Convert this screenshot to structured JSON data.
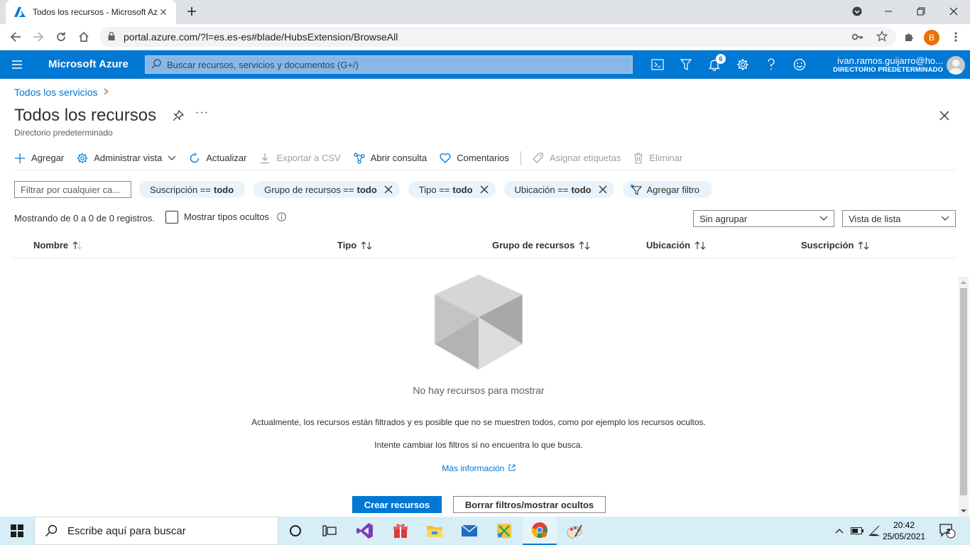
{
  "browser": {
    "tab_title": "Todos los recursos - Microsoft Azure",
    "url": "portal.azure.com/?l=es.es-es#blade/HubsExtension/BrowseAll",
    "profile_initial": "B"
  },
  "azure": {
    "brand": "Microsoft Azure",
    "search_placeholder": "Buscar recursos, servicios y documentos (G+/)",
    "notifications_count": "6",
    "user_name": "ivan.ramos.guijarro@ho...",
    "user_directory": "DIRECTORIO PREDETERMINADO"
  },
  "blade": {
    "breadcrumb": "Todos los servicios",
    "title": "Todos los recursos",
    "more": "···",
    "subtitle": "Directorio predeterminado"
  },
  "commands": {
    "add": "Agregar",
    "manage_view": "Administrar vista",
    "refresh": "Actualizar",
    "export_csv": "Exportar a CSV",
    "open_query": "Abrir consulta",
    "feedback": "Comentarios",
    "assign_tags": "Asignar etiquetas",
    "delete": "Eliminar"
  },
  "filters": {
    "placeholder": "Filtrar por cualquier ca...",
    "subscription_key": "Suscripción ==",
    "subscription_val": "todo",
    "rg_key": "Grupo de recursos ==",
    "rg_val": "todo",
    "type_key": "Tipo ==",
    "type_val": "todo",
    "location_key": "Ubicación ==",
    "location_val": "todo",
    "add_filter": "Agregar filtro"
  },
  "list": {
    "count_text": "Mostrando de 0 a 0 de 0 registros.",
    "show_hidden": "Mostrar tipos ocultos",
    "grouping": "Sin agrupar",
    "view": "Vista de lista",
    "columns": [
      "Nombre",
      "Tipo",
      "Grupo de recursos",
      "Ubicación",
      "Suscripción"
    ]
  },
  "empty": {
    "title": "No hay recursos para mostrar",
    "line1": "Actualmente, los recursos están filtrados y es posible que no se muestren todos, como por ejemplo los recursos ocultos.",
    "line2": "Intente cambiar los filtros si no encuentra lo que busca.",
    "more_info": "Más información",
    "create_btn": "Crear recursos",
    "clear_btn": "Borrar filtros/mostrar ocultos"
  },
  "taskbar": {
    "search_placeholder": "Escribe aquí para buscar",
    "time": "20:42",
    "date": "25/05/2021",
    "notif_count": "2"
  }
}
